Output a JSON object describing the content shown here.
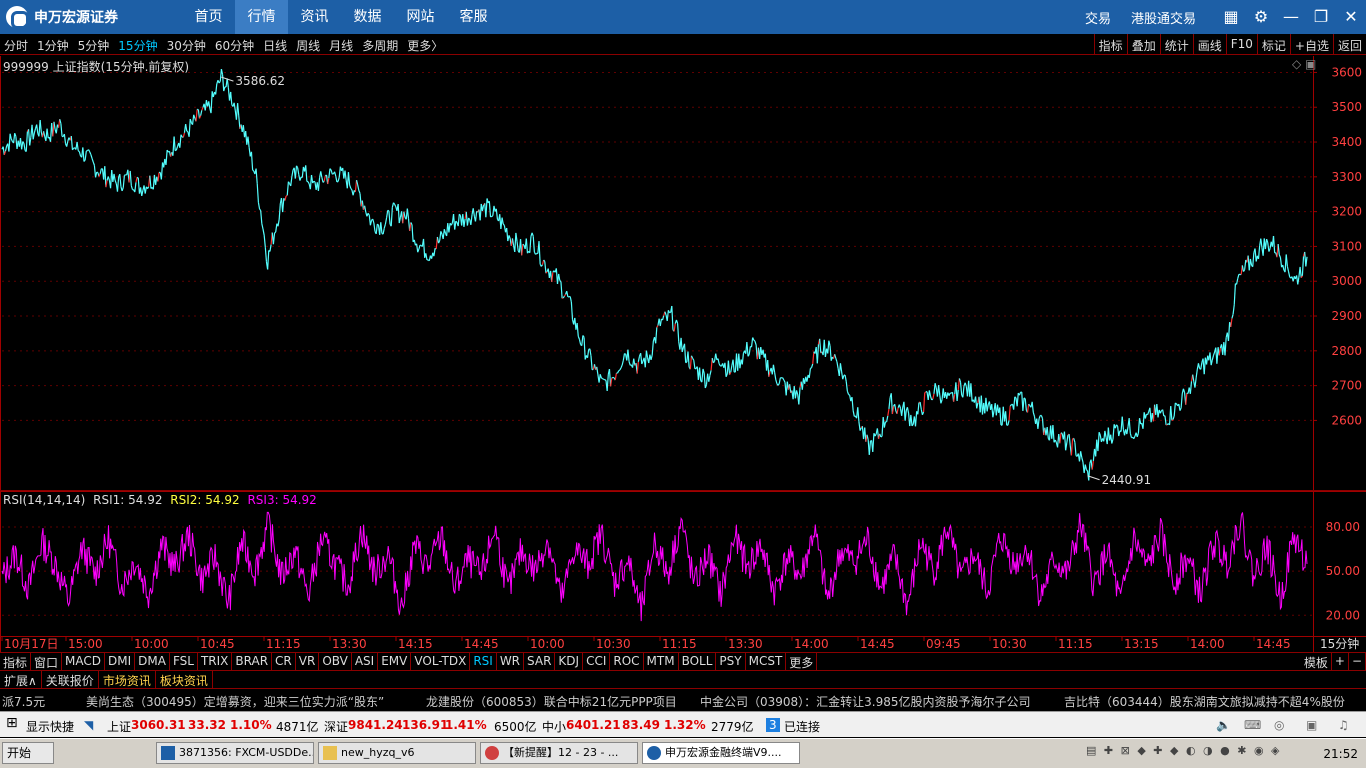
{
  "app": {
    "logo_text": "申万宏源证券"
  },
  "topnav": {
    "items": [
      "首页",
      "行情",
      "资讯",
      "数据",
      "网站",
      "客服"
    ],
    "active": "行情",
    "right_items": [
      "交易",
      "港股通交易"
    ],
    "icons": [
      "layout-icon",
      "gear-icon",
      "minimize-icon",
      "restore-icon",
      "close-icon"
    ]
  },
  "periods": {
    "items": [
      "分时",
      "1分钟",
      "5分钟",
      "15分钟",
      "30分钟",
      "60分钟",
      "日线",
      "周线",
      "月线",
      "多周期",
      "更多〉"
    ],
    "active": "15分钟"
  },
  "tools": [
    "指标",
    "叠加",
    "统计",
    "画线",
    "F10",
    "标记",
    "+自选",
    "返回"
  ],
  "main_chart": {
    "title": "999999 上证指数(15分钟.前复权)",
    "high_label": "3586.62",
    "low_label": "2440.91",
    "up_color": "#ff3030",
    "down_color": "#54ffff"
  },
  "rsi": {
    "name": "RSI(14,14,14)",
    "rsi1": "RSI1: 54.92",
    "rsi2": "RSI2: 54.92",
    "rsi3": "RSI3: 54.92",
    "line_color": "#ff00ff"
  },
  "chart_data": [
    {
      "type": "line",
      "title": "999999 上证指数(15分钟.前复权)",
      "ylim": [
        2400,
        3630
      ],
      "yticks": [
        3600,
        3500,
        3400,
        3300,
        3200,
        3100,
        3000,
        2900,
        2800,
        2700,
        2600
      ],
      "x_ticks": [
        "10月17日",
        "15:00",
        "10:00",
        "10:45",
        "11:15",
        "13:30",
        "14:15",
        "14:45",
        "10:00",
        "10:30",
        "11:15",
        "13:30",
        "14:00",
        "14:45",
        "09:45",
        "10:30",
        "11:15",
        "13:15",
        "14:00",
        "14:45"
      ],
      "period_label": "15分钟",
      "series": [
        {
          "name": "",
          "values": [
            3380,
            3410,
            3395,
            3440,
            3420,
            3450,
            3390,
            3370,
            3330,
            3300,
            3280,
            3300,
            3270,
            3290,
            3330,
            3400,
            3430,
            3470,
            3500,
            3586.62,
            3520,
            3430,
            3300,
            3060,
            3200,
            3290,
            3320,
            3270,
            3300,
            3310,
            3290,
            3250,
            3170,
            3160,
            3200,
            3190,
            3110,
            3080,
            3120,
            3170,
            3180,
            3200,
            3210,
            3180,
            3130,
            3090,
            3120,
            3050,
            3010,
            2950,
            2840,
            2770,
            2700,
            2730,
            2800,
            2760,
            2780,
            2880,
            2900,
            2800,
            2750,
            2720,
            2790,
            2740,
            2780,
            2820,
            2770,
            2730,
            2690,
            2670,
            2750,
            2820,
            2790,
            2720,
            2620,
            2520,
            2560,
            2650,
            2630,
            2600,
            2660,
            2690,
            2650,
            2700,
            2680,
            2640,
            2620,
            2610,
            2660,
            2640,
            2590,
            2560,
            2540,
            2520,
            2440.91,
            2540,
            2560,
            2590,
            2570,
            2600,
            2620,
            2610,
            2650,
            2700,
            2760,
            2780,
            2820,
            3000,
            3050,
            3100,
            3110,
            3060,
            3000,
            3070
          ]
        }
      ]
    },
    {
      "type": "line",
      "title": "RSI(14,14,14)",
      "ylim": [
        10,
        95
      ],
      "yticks": [
        80,
        50,
        20
      ],
      "ytick_labels": [
        "80.00",
        "50.00",
        "20.00"
      ],
      "series": [
        {
          "name": "RSI1",
          "values": [
            45,
            62,
            38,
            70,
            55,
            30,
            66,
            48,
            72,
            40,
            58,
            35,
            68,
            52,
            75,
            44,
            60,
            28,
            70,
            50,
            82,
            46,
            64,
            33,
            72,
            55,
            40,
            78,
            48,
            62,
            25,
            68,
            52,
            74,
            38,
            58,
            46,
            80,
            36,
            64,
            50,
            72,
            30,
            66,
            54,
            76,
            42,
            58,
            22,
            70,
            48,
            84,
            40,
            62,
            34,
            74,
            52,
            68,
            36,
            60,
            46,
            78,
            30,
            64,
            56,
            72,
            38,
            60,
            26,
            70,
            50,
            80,
            44,
            62,
            36,
            74,
            54,
            66,
            32,
            58,
            48,
            82,
            40,
            64,
            28,
            72,
            52,
            76,
            42,
            60,
            34,
            70,
            56,
            86,
            46,
            68,
            30,
            74,
            54.92
          ]
        }
      ]
    }
  ],
  "indicators": {
    "items": [
      "指标",
      "窗口",
      "MACD",
      "DMI",
      "DMA",
      "FSL",
      "TRIX",
      "BRAR",
      "CR",
      "VR",
      "OBV",
      "ASI",
      "EMV",
      "VOL-TDX",
      "RSI",
      "WR",
      "SAR",
      "KDJ",
      "CCI",
      "ROC",
      "MTM",
      "BOLL",
      "PSY",
      "MCST",
      "更多"
    ],
    "active": "RSI",
    "right": [
      "模板",
      "+",
      "−"
    ]
  },
  "tabs": [
    "扩展∧",
    "关联报价",
    "市场资讯",
    "板块资讯"
  ],
  "ticker": [
    "派7.5元",
    "美尚生态（300495）定增募资，迎来三位实力派“股东”",
    "龙建股份（600853）联合中标21亿元PPP项目",
    "中金公司（03908）：汇金转让3.985亿股内资股予海尔子公司",
    "吉比特（603444）股东湖南文旅拟减持不超4%股份"
  ],
  "status": {
    "shortcut": "显示快捷",
    "sh_label": "上证",
    "sh_value": "3060.31",
    "sh_change": "33.32",
    "sh_pct": "1.10%",
    "sh_amount": "4871亿",
    "sz_label": "深证",
    "sz_value": "9841.24",
    "sz_change": "136.91",
    "sz_pct": "1.41%",
    "sz_amount": "6500亿",
    "zx_label": "中小",
    "zx_value": "6401.21",
    "zx_change": "83.49",
    "zx_pct": "1.32%",
    "zx_amount": "2779亿",
    "conn_count": "3",
    "conn": "已连接"
  },
  "taskbar": {
    "start": "开始",
    "tasks": [
      "3871356: FXCM-USDDe...",
      "new_hyzq_v6",
      "【新提醒】12 - 23 - ...",
      "申万宏源金融终端V9...."
    ],
    "clock": "21:52"
  }
}
